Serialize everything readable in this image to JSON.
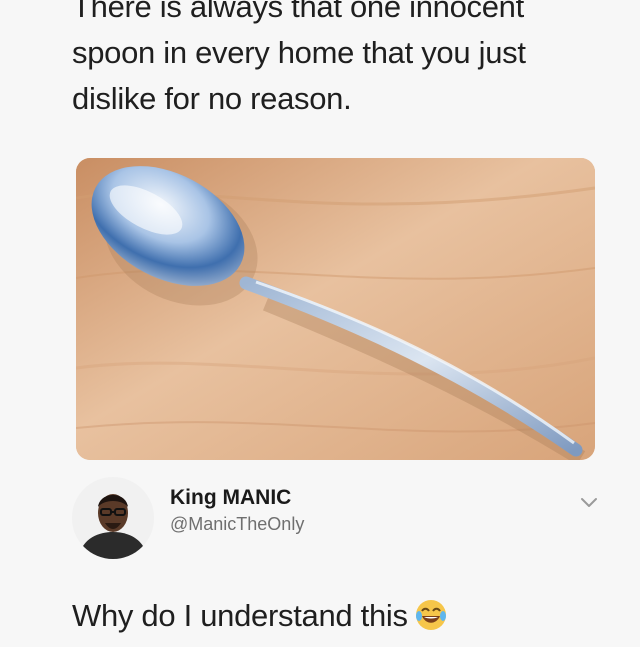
{
  "tweet": {
    "text_lines": [
      "There is always that one innocent",
      "spoon in every home that you just",
      "dislike for no reason."
    ]
  },
  "photo": {
    "subject": "spoon on wooden table",
    "colors": {
      "wood": "#e3b890",
      "spoon": "#b9cbe0"
    }
  },
  "reply": {
    "author_name": "King MANIC",
    "author_handle": "@ManicTheOnly",
    "text": "Why do I understand this",
    "emoji": "face-with-tears-of-joy-icon"
  },
  "icons": {
    "menu": "chevron-down-icon"
  }
}
